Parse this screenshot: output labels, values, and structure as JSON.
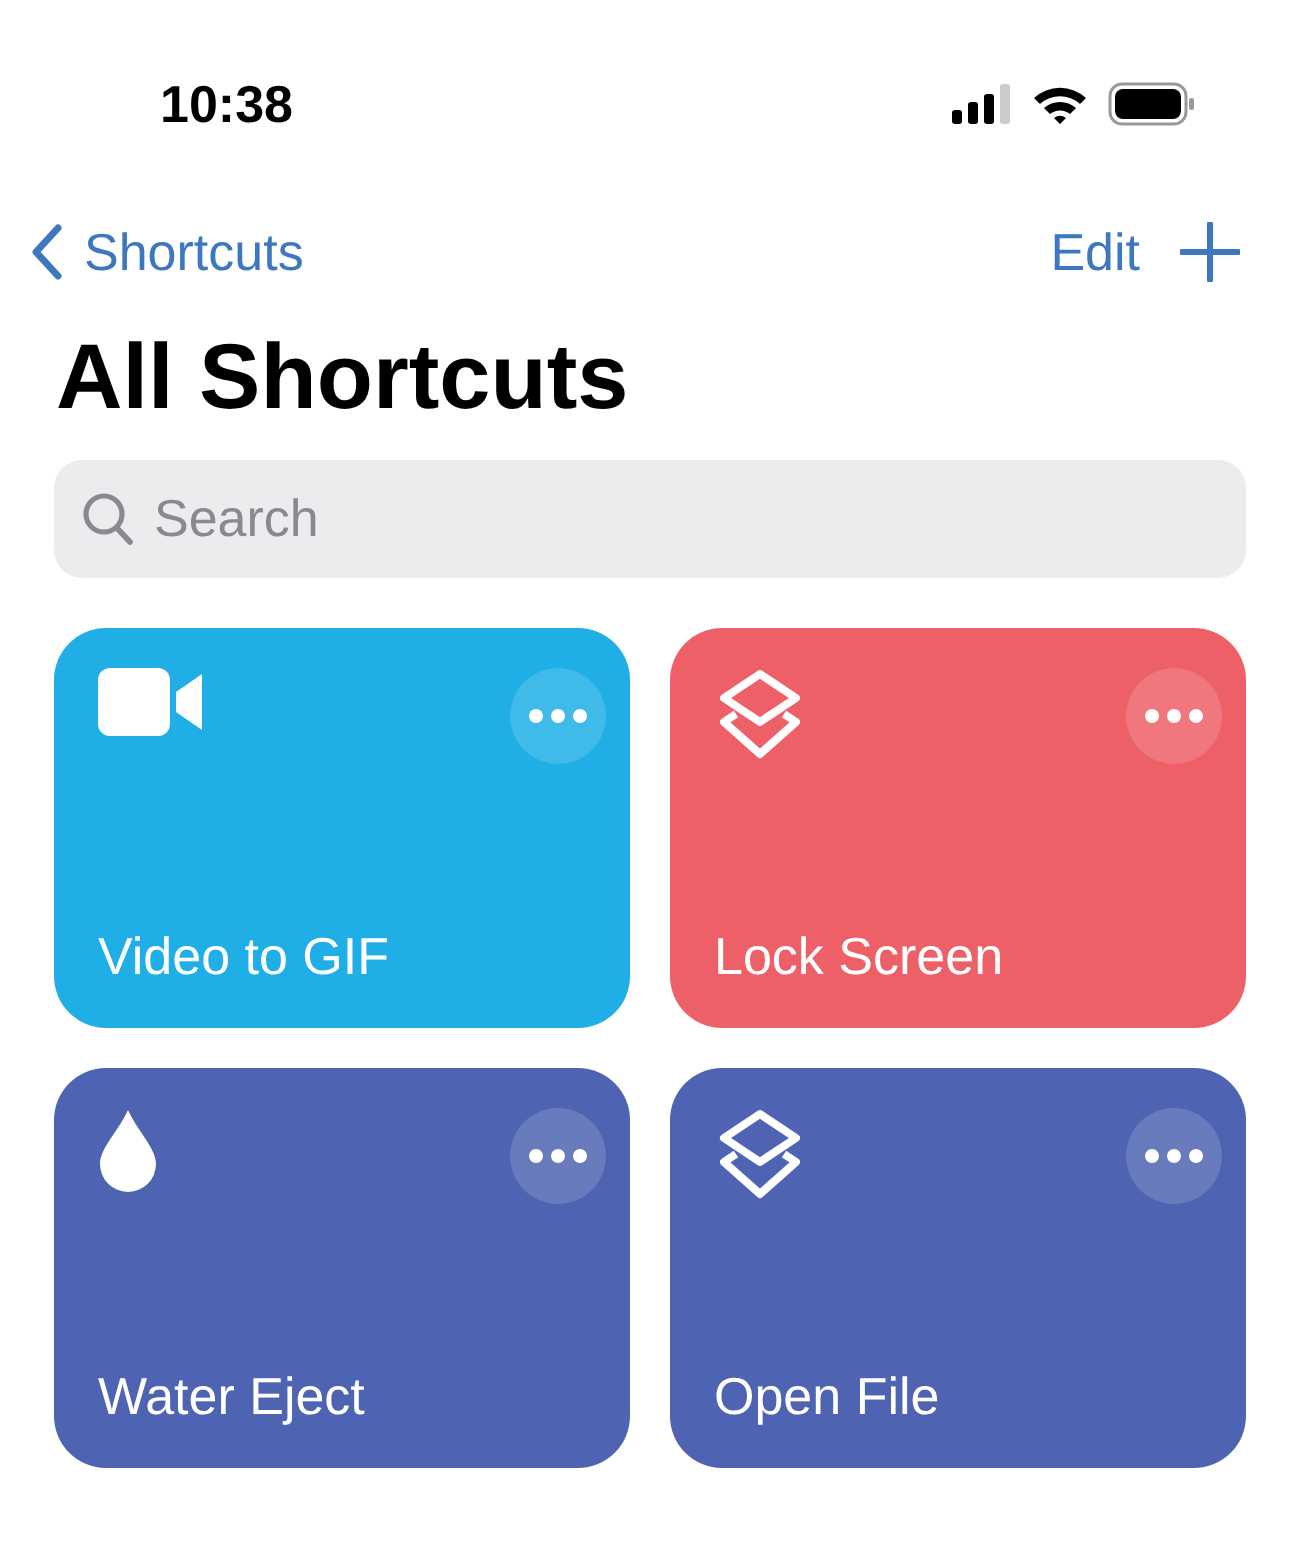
{
  "status_bar": {
    "time": "10:38"
  },
  "nav": {
    "back": "Shortcuts",
    "edit": "Edit"
  },
  "title": "All Shortcuts",
  "search": {
    "placeholder": "Search"
  },
  "shortcuts": [
    {
      "name": "Video to GIF",
      "color": "#1faee6",
      "kind": "video"
    },
    {
      "name": "Lock Screen",
      "color": "#ee6068",
      "kind": "layers"
    },
    {
      "name": "Water Eject",
      "color": "#4e64b2",
      "kind": "drop"
    },
    {
      "name": "Open File",
      "color": "#4e64b2",
      "kind": "layers"
    }
  ]
}
